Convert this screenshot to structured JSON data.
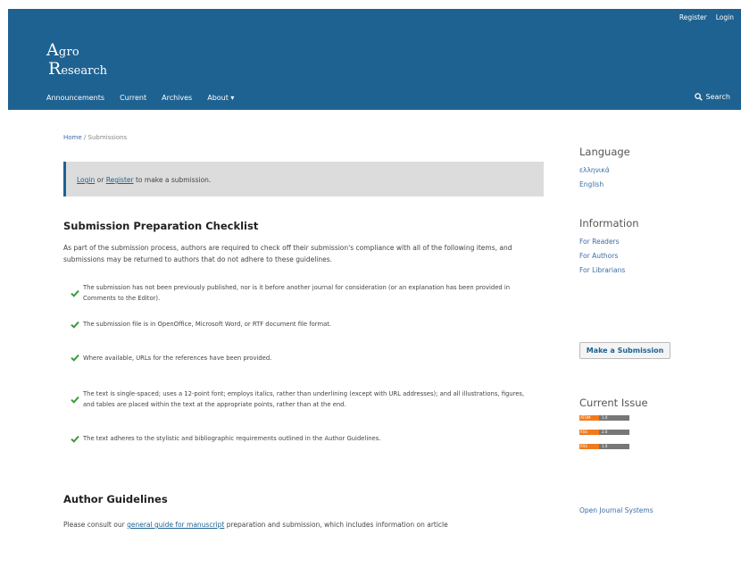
{
  "header": {
    "user_nav": {
      "register": "Register",
      "login": "Login"
    },
    "logo": {
      "line1_cap": "A",
      "line1_rest": "gro",
      "line2_cap": "R",
      "line2_rest": "esearch"
    },
    "nav": {
      "announcements": "Announcements",
      "current": "Current",
      "archives": "Archives",
      "about": "About ▾"
    },
    "search_label": "Search"
  },
  "breadcrumb": {
    "home": "Home",
    "separator": "/",
    "current": "Submissions"
  },
  "notice": {
    "login": "Login",
    "or": "or",
    "register": "Register",
    "rest": "to make a submission."
  },
  "checklist": {
    "title": "Submission Preparation Checklist",
    "intro": "As part of the submission process, authors are required to check off their submission's compliance with all of the following items, and submissions may be returned to authors that do not adhere to these guidelines.",
    "items": [
      "The submission has not been previously published, nor is it before another journal for consideration (or an explanation has been provided in Comments to the Editor).",
      "The submission file is in OpenOffice, Microsoft Word, or RTF document file format.",
      "Where available, URLs for the references have been provided.",
      "The text is single-spaced; uses a 12-point font; employs italics, rather than underlining (except with URL addresses); and all illustrations, figures, and tables are placed within the text at the appropriate points, rather than at the end.",
      "The text adheres to the stylistic and bibliographic requirements outlined in the Author Guidelines."
    ]
  },
  "author_guidelines": {
    "title": "Author Guidelines",
    "consult_prefix": "Please consult our",
    "consult_link": "general guide for manuscript",
    "consult_suffix": "preparation and submission, which includes information on article"
  },
  "sidebar": {
    "language": {
      "title": "Language",
      "options": [
        "ελληνικά",
        "English"
      ]
    },
    "information": {
      "title": "Information",
      "links": [
        "For Readers",
        "For Authors",
        "For Librarians"
      ]
    },
    "submit_button": "Make a Submission",
    "current_issue": {
      "title": "Current Issue",
      "feeds": [
        {
          "left": "ATOM",
          "right": "1.0"
        },
        {
          "left": "RSS",
          "right": "2.0"
        },
        {
          "left": "RSS",
          "right": "1.0"
        }
      ]
    },
    "ojs_link": "Open Journal Systems"
  },
  "colors": {
    "header_bg": "#1e6291",
    "check_green": "#3c9a3c",
    "link": "#3b6da8"
  }
}
